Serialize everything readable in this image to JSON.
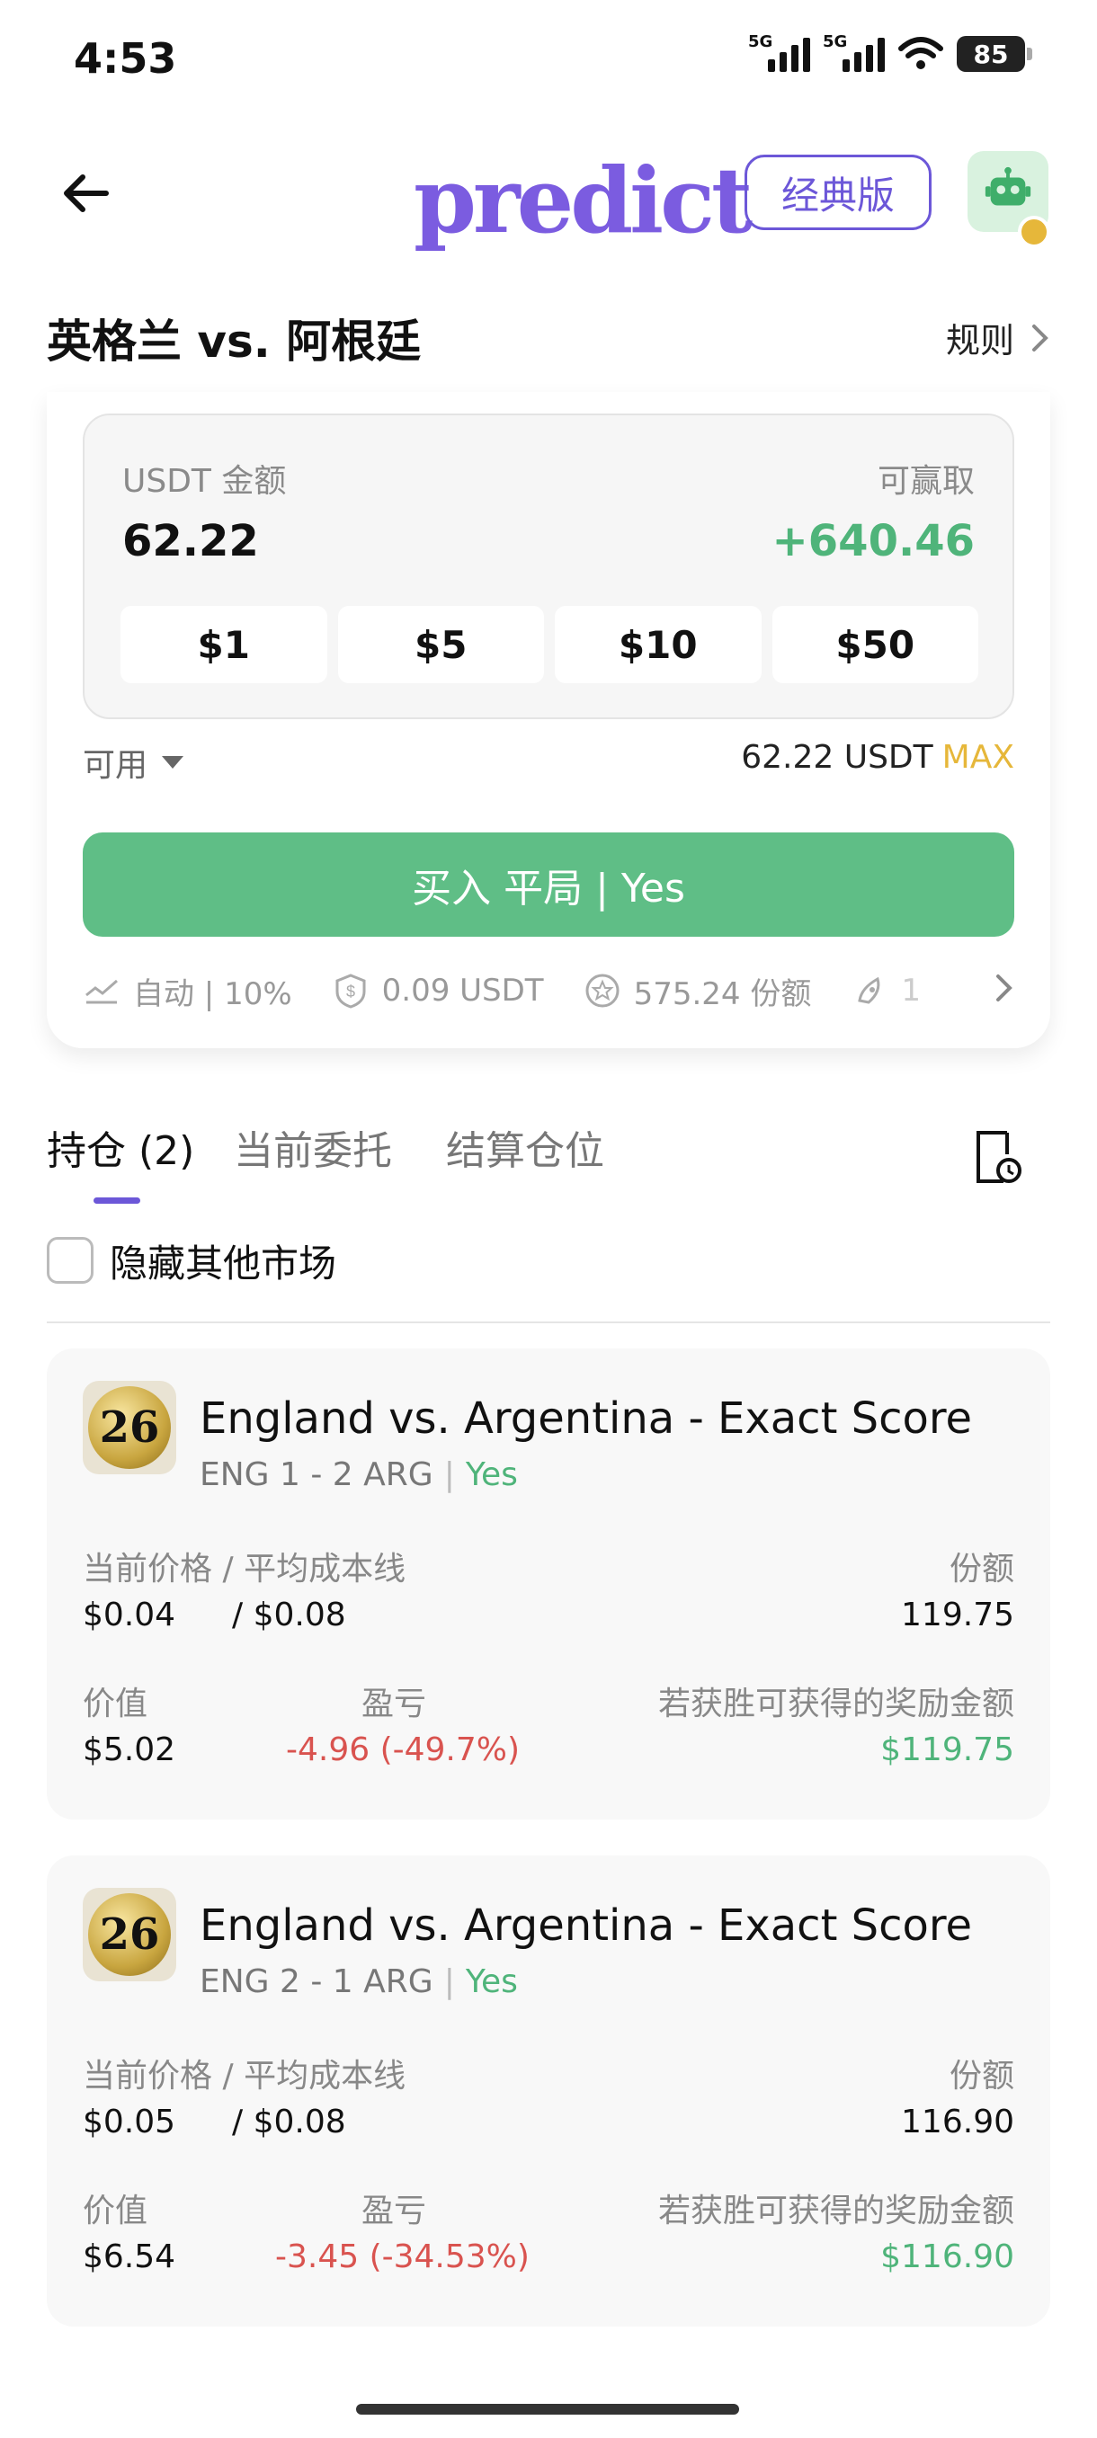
{
  "status_bar": {
    "time": "4:53",
    "sim1": "5G",
    "sim2": "5G",
    "battery": "85"
  },
  "nav": {
    "logo": "predict",
    "classic_label": "经典版"
  },
  "match": {
    "title": "英格兰 vs. 阿根廷",
    "rules_label": "规则"
  },
  "order": {
    "amount_label": "USDT 金额",
    "amount_value": "62.22",
    "win_label": "可赢取",
    "win_value": "+640.46",
    "quick_amounts": [
      "$1",
      "$5",
      "$10",
      "$50"
    ],
    "available_label": "可用",
    "available_value": "62.22 USDT",
    "max_label": "MAX",
    "buy_label": "买入 平局 | Yes",
    "meta": {
      "slippage": "自动 | 10%",
      "fee": "0.09 USDT",
      "shares": "575.24 份额",
      "extra": "1"
    }
  },
  "tabs": {
    "positions": "持仓 (2)",
    "orders": "当前委托",
    "settled": "结算仓位"
  },
  "hide_other_markets": "隐藏其他市场",
  "labels": {
    "price_current": "当前价格",
    "price_sep": "/",
    "price_avg": "平均成本线",
    "shares": "份额",
    "value": "价值",
    "pnl": "盈亏",
    "reward": "若获胜可获得的奖励金额"
  },
  "positions": [
    {
      "badge": "26",
      "title": "England vs. Argentina - Exact Score",
      "market": "ENG 1 - 2 ARG",
      "outcome": "Yes",
      "current_price": "$0.04",
      "avg_cost": "/ $0.08",
      "shares": "119.75",
      "value": "$5.02",
      "pnl": "-4.96 (-49.7%)",
      "reward": "$119.75"
    },
    {
      "badge": "26",
      "title": "England vs. Argentina - Exact Score",
      "market": "ENG 2 - 1 ARG",
      "outcome": "Yes",
      "current_price": "$0.05",
      "avg_cost": "/ $0.08",
      "shares": "116.90",
      "value": "$6.54",
      "pnl": "-3.45 (-34.53%)",
      "reward": "$116.90"
    }
  ]
}
